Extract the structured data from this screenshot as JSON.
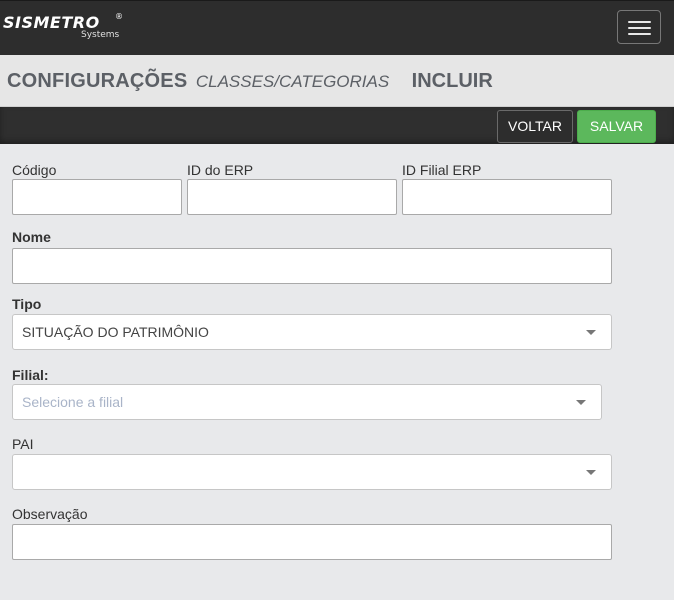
{
  "header": {
    "logo_text": "SISMETRO",
    "logo_registered": "®",
    "logo_subtitle": "Systems",
    "menu_icon": "hamburger-menu-icon"
  },
  "title": {
    "section": "CONFIGURAÇÕES",
    "subsection": "CLASSES/CATEGORIAS",
    "action": "INCLUIR"
  },
  "toolbar": {
    "back_label": "VOLTAR",
    "save_label": "SALVAR",
    "save_color": "#5cb85c"
  },
  "form": {
    "codigo": {
      "label": "Código",
      "value": ""
    },
    "id_erp": {
      "label": "ID do ERP",
      "value": ""
    },
    "id_filial_erp": {
      "label": "ID Filial ERP",
      "value": ""
    },
    "nome": {
      "label": "Nome",
      "value": ""
    },
    "tipo": {
      "label": "Tipo",
      "selected": "SITUAÇÃO DO PATRIMÔNIO"
    },
    "filial": {
      "label": "Filial:",
      "placeholder": "Selecione a filial",
      "selected": ""
    },
    "pai": {
      "label": "PAI",
      "selected": ""
    },
    "observacao": {
      "label": "Observação",
      "value": ""
    }
  }
}
